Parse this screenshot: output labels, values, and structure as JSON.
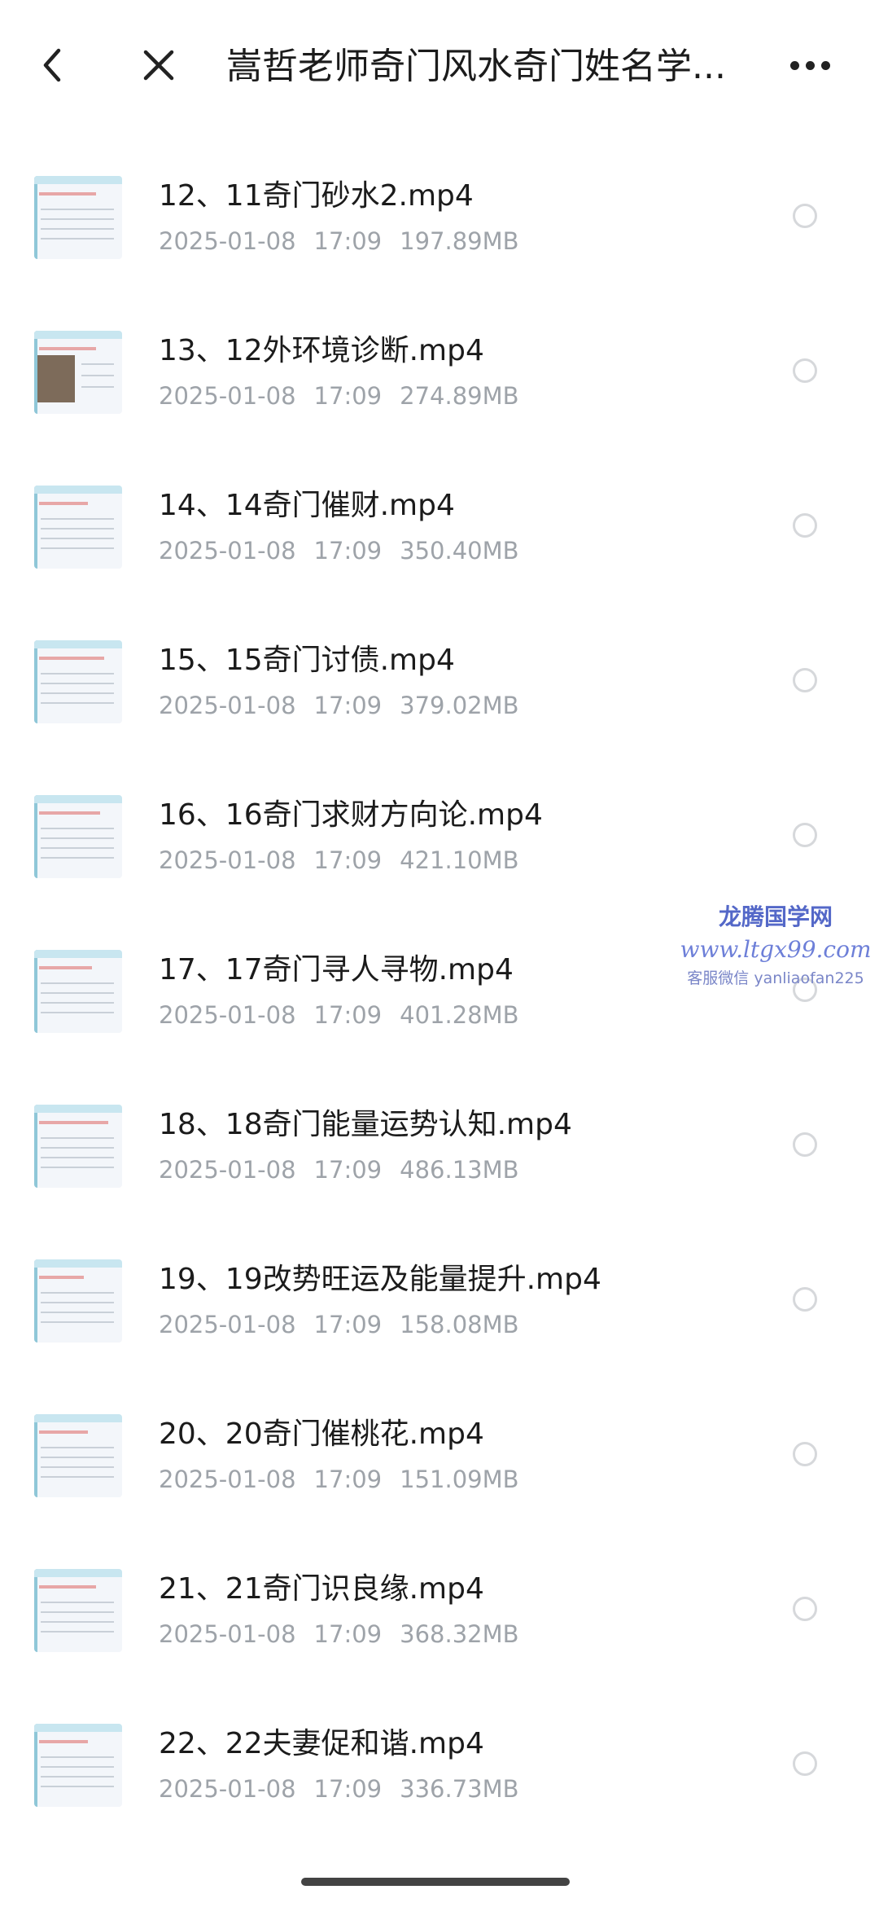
{
  "header": {
    "title": "嵩哲老师奇门风水奇门姓名学..."
  },
  "icons": {
    "back": "back-arrow-icon",
    "close": "close-icon",
    "more": "more-horizontal-icon"
  },
  "files": [
    {
      "name": "12、11奇门砂水2.mp4",
      "date": "2025-01-08",
      "time": "17:09",
      "size": "197.89MB"
    },
    {
      "name": "13、12外环境诊断.mp4",
      "date": "2025-01-08",
      "time": "17:09",
      "size": "274.89MB"
    },
    {
      "name": "14、14奇门催财.mp4",
      "date": "2025-01-08",
      "time": "17:09",
      "size": "350.40MB"
    },
    {
      "name": "15、15奇门讨债.mp4",
      "date": "2025-01-08",
      "time": "17:09",
      "size": "379.02MB"
    },
    {
      "name": "16、16奇门求财方向论.mp4",
      "date": "2025-01-08",
      "time": "17:09",
      "size": "421.10MB"
    },
    {
      "name": "17、17奇门寻人寻物.mp4",
      "date": "2025-01-08",
      "time": "17:09",
      "size": "401.28MB"
    },
    {
      "name": "18、18奇门能量运势认知.mp4",
      "date": "2025-01-08",
      "time": "17:09",
      "size": "486.13MB"
    },
    {
      "name": "19、19改势旺运及能量提升.mp4",
      "date": "2025-01-08",
      "time": "17:09",
      "size": "158.08MB"
    },
    {
      "name": "20、20奇门催桃花.mp4",
      "date": "2025-01-08",
      "time": "17:09",
      "size": "151.09MB"
    },
    {
      "name": "21、21奇门识良缘.mp4",
      "date": "2025-01-08",
      "time": "17:09",
      "size": "368.32MB"
    },
    {
      "name": "22、22夫妻促和谐.mp4",
      "date": "2025-01-08",
      "time": "17:09",
      "size": "336.73MB"
    }
  ],
  "watermark": {
    "line1": "龙腾国学网",
    "line2": "www.ltgx99.com",
    "line3": "客服微信 yanliaofan225"
  },
  "colors": {
    "text": "#1b1b1b",
    "meta": "#9ea3a9",
    "radio_border": "#d6d8db",
    "watermark": "#5468c8"
  }
}
